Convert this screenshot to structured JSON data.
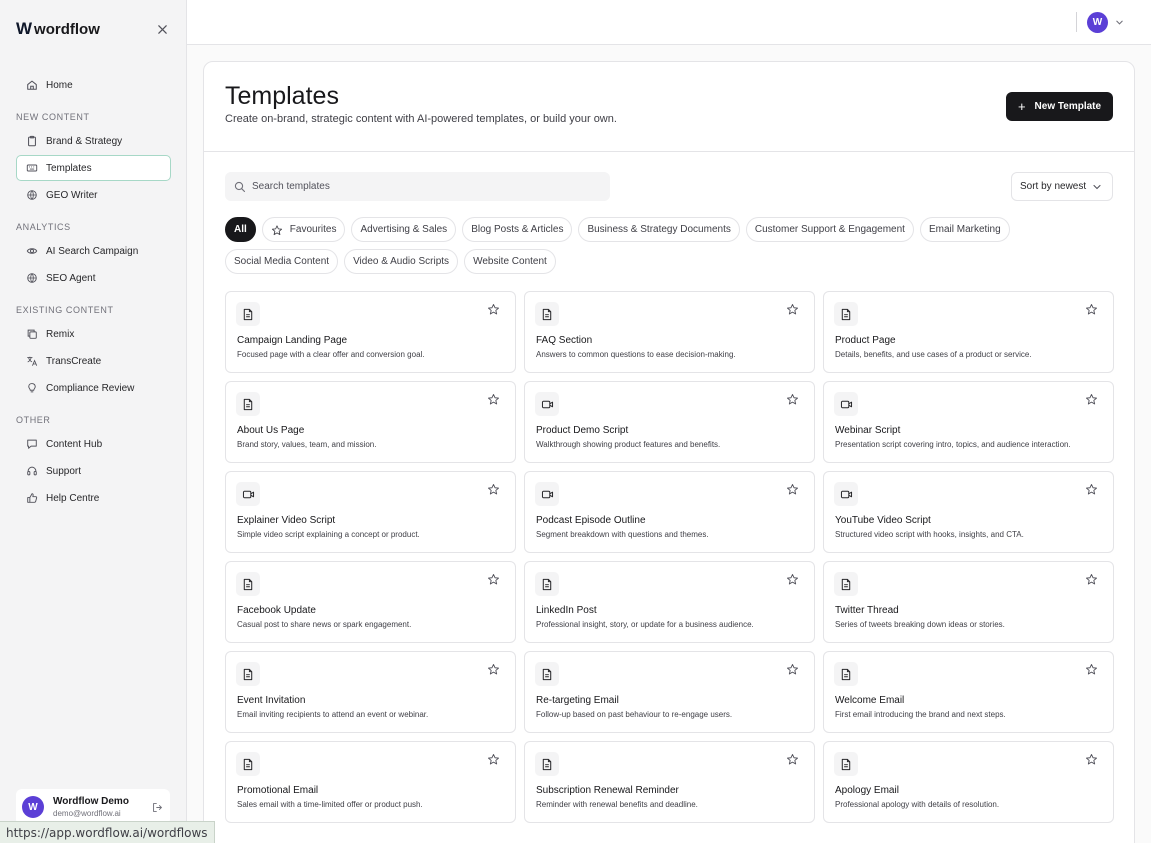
{
  "brand": {
    "name": "wordflow",
    "mark": "W"
  },
  "sidebar": {
    "home": "Home",
    "sections": [
      {
        "title": "NEW CONTENT",
        "items": [
          {
            "label": "Brand & Strategy",
            "icon": "clipboard-icon"
          },
          {
            "label": "Templates",
            "icon": "keyboard-icon",
            "active": true
          },
          {
            "label": "GEO Writer",
            "icon": "globe-icon"
          }
        ]
      },
      {
        "title": "ANALYTICS",
        "items": [
          {
            "label": "AI Search Campaign",
            "icon": "eye-icon"
          },
          {
            "label": "SEO Agent",
            "icon": "globe-icon"
          }
        ]
      },
      {
        "title": "EXISTING CONTENT",
        "items": [
          {
            "label": "Remix",
            "icon": "copy-icon"
          },
          {
            "label": "TransCreate",
            "icon": "translate-icon"
          },
          {
            "label": "Compliance Review",
            "icon": "lightbulb-icon"
          }
        ]
      },
      {
        "title": "OTHER",
        "items": [
          {
            "label": "Content Hub",
            "icon": "chat-icon"
          },
          {
            "label": "Support",
            "icon": "headset-icon"
          },
          {
            "label": "Help Centre",
            "icon": "thumbs-up-icon"
          }
        ]
      }
    ],
    "user": {
      "initial": "W",
      "name": "Wordflow Demo",
      "email": "demo@wordflow.ai"
    }
  },
  "topbar": {
    "avatar_initial": "W"
  },
  "main": {
    "title": "Templates",
    "subtitle": "Create on-brand, strategic content with AI-powered templates, or build your own.",
    "new_button": "New Template",
    "search_placeholder": "Search templates",
    "sort_label": "Sort by newest",
    "filters_row1": [
      "All",
      "Favourites",
      "Advertising & Sales",
      "Blog Posts & Articles",
      "Business & Strategy Documents",
      "Customer Support & Engagement",
      "Email Marketing"
    ],
    "filters_row2": [
      "Social Media Content",
      "Video & Audio Scripts",
      "Website Content"
    ],
    "active_filter": "All",
    "cards": [
      {
        "title": "Campaign Landing Page",
        "desc": "Focused page with a clear offer and conversion goal.",
        "icon": "document-icon"
      },
      {
        "title": "FAQ Section",
        "desc": "Answers to common questions to ease decision-making.",
        "icon": "document-icon"
      },
      {
        "title": "Product Page",
        "desc": "Details, benefits, and use cases of a product or service.",
        "icon": "document-icon"
      },
      {
        "title": "About Us Page",
        "desc": "Brand story, values, team, and mission.",
        "icon": "document-icon"
      },
      {
        "title": "Product Demo Script",
        "desc": "Walkthrough showing product features and benefits.",
        "icon": "video-icon"
      },
      {
        "title": "Webinar Script",
        "desc": "Presentation script covering intro, topics, and audience interaction.",
        "icon": "video-icon"
      },
      {
        "title": "Explainer Video Script",
        "desc": "Simple video script explaining a concept or product.",
        "icon": "video-icon"
      },
      {
        "title": "Podcast Episode Outline",
        "desc": "Segment breakdown with questions and themes.",
        "icon": "video-icon"
      },
      {
        "title": "YouTube Video Script",
        "desc": "Structured video script with hooks, insights, and CTA.",
        "icon": "video-icon"
      },
      {
        "title": "Facebook Update",
        "desc": "Casual post to share news or spark engagement.",
        "icon": "document-icon"
      },
      {
        "title": "LinkedIn Post",
        "desc": "Professional insight, story, or update for a business audience.",
        "icon": "document-icon"
      },
      {
        "title": "Twitter Thread",
        "desc": "Series of tweets breaking down ideas or stories.",
        "icon": "document-icon"
      },
      {
        "title": "Event Invitation",
        "desc": "Email inviting recipients to attend an event or webinar.",
        "icon": "document-icon"
      },
      {
        "title": "Re-targeting Email",
        "desc": "Follow-up based on past behaviour to re-engage users.",
        "icon": "document-icon"
      },
      {
        "title": "Welcome Email",
        "desc": "First email introducing the brand and next steps.",
        "icon": "document-icon"
      },
      {
        "title": "Promotional Email",
        "desc": "Sales email with a time-limited offer or product push.",
        "icon": "document-icon"
      },
      {
        "title": "Subscription Renewal Reminder",
        "desc": "Reminder with renewal benefits and deadline.",
        "icon": "document-icon"
      },
      {
        "title": "Apology Email",
        "desc": "Professional apology with details of resolution.",
        "icon": "document-icon"
      }
    ]
  },
  "status_url": "https://app.wordflow.ai/wordflows",
  "colors": {
    "accent": "#5b3fd6",
    "active_border": "#a7d8c7",
    "primary_button": "#18181b"
  }
}
